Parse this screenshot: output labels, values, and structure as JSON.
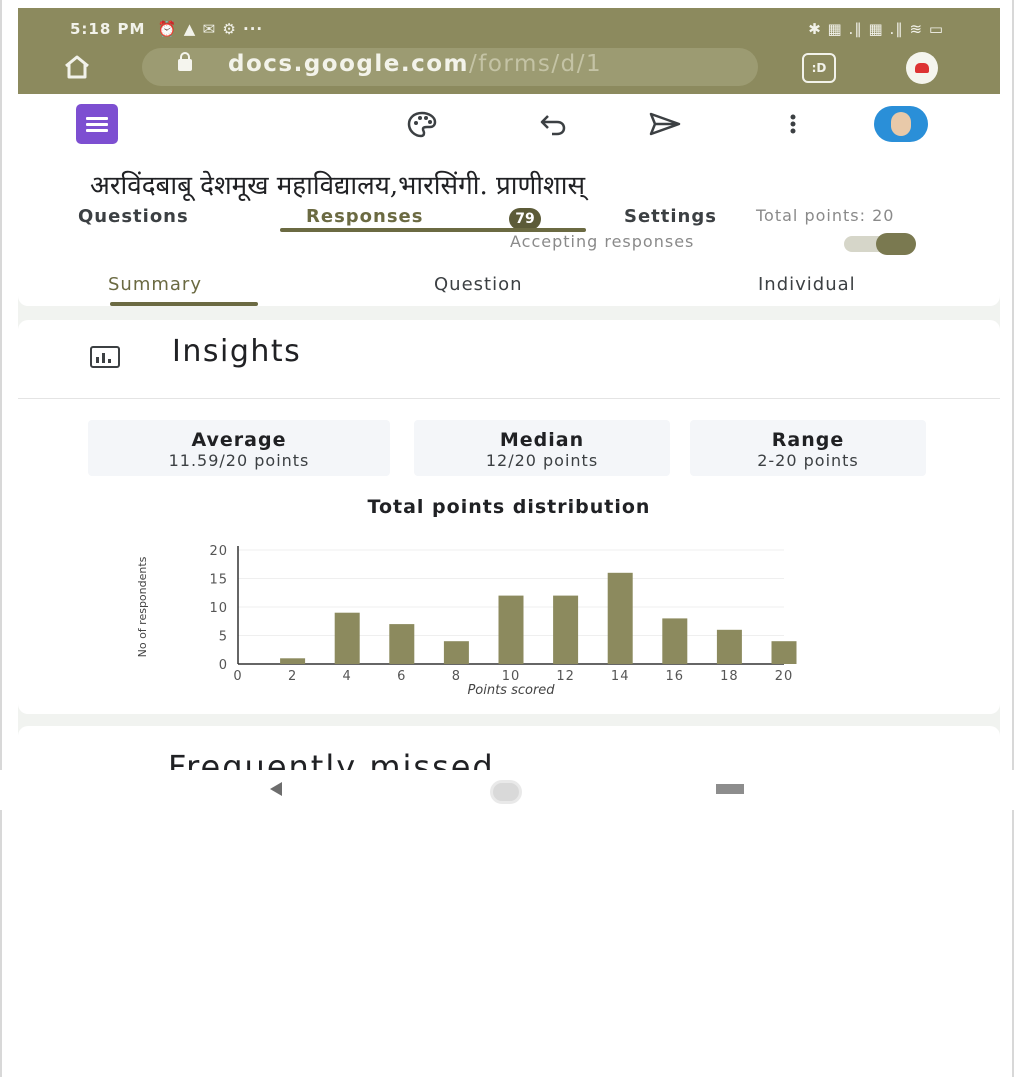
{
  "status_bar": {
    "time": "5:18 PM",
    "icons_left": "⏰ ▲ ✉ ⚙ ···",
    "icons_right": "✱ ▦ .∥ ▦ .∥ ≋ ▭"
  },
  "url_bar": {
    "host": "docs.google.com",
    "path": "/forms/d/1",
    "tab_count_icon": ":D"
  },
  "toolbar": {
    "icons": [
      "palette-icon",
      "undo-icon",
      "send-icon",
      "more-vert-icon"
    ]
  },
  "form": {
    "title": "अरविंदबाबू देशमूख महाविद्यालय,भारसिंगी. प्राणीशास्",
    "tabs": {
      "questions": "Questions",
      "responses": "Responses",
      "response_count": "79",
      "settings": "Settings"
    },
    "total_points": "Total points: 20"
  },
  "summary": {
    "accepting": "Accepting responses",
    "tabs": [
      "Summary",
      "Question",
      "Individual"
    ]
  },
  "insights": {
    "title": "Insights",
    "stats": [
      {
        "label": "Average",
        "value": "11.59/20 points"
      },
      {
        "label": "Median",
        "value": "12/20 points"
      },
      {
        "label": "Range",
        "value": "2-20 points"
      }
    ]
  },
  "chart_data": {
    "type": "bar",
    "title": "Total points distribution",
    "xlabel": "Points scored",
    "ylabel": "No of respondents",
    "x": [
      2,
      4,
      6,
      8,
      10,
      12,
      14,
      16,
      18,
      20
    ],
    "values": [
      1,
      9,
      7,
      4,
      12,
      12,
      16,
      8,
      6,
      4
    ],
    "xticks": [
      0,
      2,
      4,
      6,
      8,
      10,
      12,
      14,
      16,
      18,
      20
    ],
    "yticks": [
      0,
      5,
      10,
      15,
      20
    ],
    "xlim": [
      0,
      20
    ],
    "ylim": [
      0,
      20
    ],
    "bar_color": "#8c8a5e"
  },
  "missed": {
    "title": "Frequently missed"
  },
  "colors": {
    "theme": "#8c8a5e",
    "accent": "#6b6a42",
    "forms_purple": "#7d4fd1"
  }
}
